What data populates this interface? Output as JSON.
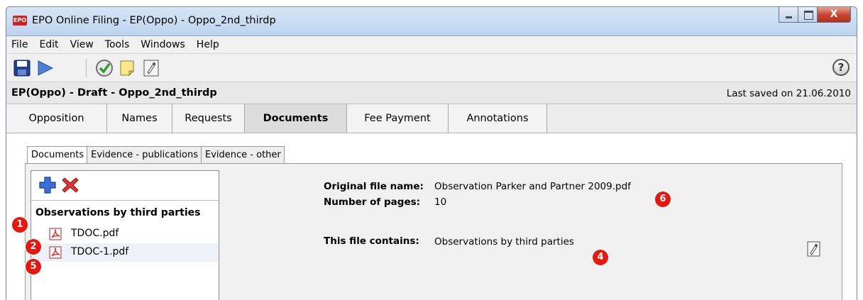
{
  "window": {
    "logo_text": "EPO",
    "title": "EPO Online Filing - EP(Oppo) - Oppo_2nd_thirdp",
    "close_glyph": "X"
  },
  "menu": [
    "File",
    "Edit",
    "View",
    "Tools",
    "Windows",
    "Help"
  ],
  "toolbar": {
    "icons": [
      "save-icon",
      "send-icon",
      "validate-check-icon",
      "sticky-note-icon",
      "sign-icon"
    ],
    "help_glyph": "?"
  },
  "file": {
    "title": "EP(Oppo) - Draft - Oppo_2nd_thirdp",
    "last_saved": "Last saved on 21.06.2010"
  },
  "main_tabs": [
    {
      "label": "Opposition",
      "active": false
    },
    {
      "label": "Names",
      "active": false
    },
    {
      "label": "Requests",
      "active": false
    },
    {
      "label": "Documents",
      "active": true
    },
    {
      "label": "Fee Payment",
      "active": false
    },
    {
      "label": "Annotations",
      "active": false
    }
  ],
  "sub_tabs": [
    {
      "label": "Documents",
      "active": true
    },
    {
      "label": "Evidence - publications",
      "active": false
    },
    {
      "label": "Evidence - other",
      "active": false
    }
  ],
  "doc_list": {
    "group_label": "Observations by third parties",
    "items": [
      {
        "label": "TDOC.pdf",
        "selected": false
      },
      {
        "label": "TDOC-1.pdf",
        "selected": true
      }
    ]
  },
  "details": {
    "original_file_name_label": "Original file name:",
    "original_file_name": "Observation Parker and Partner 2009.pdf",
    "number_of_pages_label": "Number of pages:",
    "number_of_pages": "10",
    "file_contains_label": "This file contains:",
    "file_contains": "Observations by third parties"
  },
  "markers": [
    "1",
    "2",
    "5",
    "4",
    "6"
  ],
  "colors": {
    "marker": "#e8160c",
    "title_gradient": "#c7daf0",
    "close_button": "#c4432d"
  }
}
